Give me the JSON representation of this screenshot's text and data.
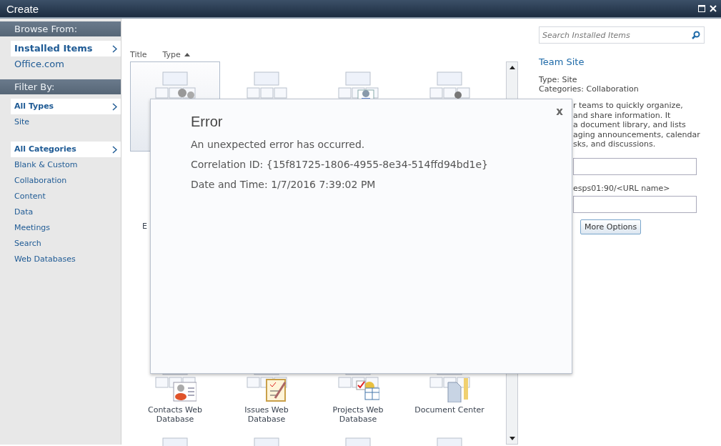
{
  "window": {
    "title": "Create"
  },
  "sidebar": {
    "sections": [
      {
        "header": "Browse From:",
        "groups": [
          {
            "items": [
              {
                "label": "Installed Items",
                "selected": true
              },
              {
                "label": "Office.com",
                "selected": false
              }
            ]
          }
        ]
      },
      {
        "header": "Filter By:",
        "groups": [
          {
            "items": [
              {
                "label": "All Types",
                "selected": true
              },
              {
                "label": "Site",
                "selected": false
              }
            ]
          },
          {
            "items": [
              {
                "label": "All Categories",
                "selected": true
              },
              {
                "label": "Blank & Custom",
                "selected": false
              },
              {
                "label": "Collaboration",
                "selected": false
              },
              {
                "label": "Content",
                "selected": false
              },
              {
                "label": "Data",
                "selected": false
              },
              {
                "label": "Meetings",
                "selected": false
              },
              {
                "label": "Search",
                "selected": false
              },
              {
                "label": "Web Databases",
                "selected": false
              }
            ]
          }
        ]
      }
    ]
  },
  "sort_columns": [
    {
      "label": "Title",
      "sorted": false
    },
    {
      "label": "Type",
      "sorted": true
    }
  ],
  "grid": {
    "rows": [
      {
        "kind": "icons",
        "tiles": [
          {
            "selected": true
          },
          {
            "selected": false
          },
          {
            "selected": false
          },
          {
            "selected": false
          }
        ]
      },
      {
        "kind": "partial",
        "tiles": [
          {
            "label": "E"
          }
        ]
      },
      {
        "kind": "full",
        "tiles": [
          {
            "label": "Contacts Web Database"
          },
          {
            "label": "Issues Web Database"
          },
          {
            "label": "Projects Web Database"
          },
          {
            "label": "Document Center"
          }
        ]
      },
      {
        "kind": "cut"
      }
    ]
  },
  "details": {
    "search": {
      "placeholder": "Search Installed Items"
    },
    "title": "Team Site",
    "type": "Type: Site",
    "categories": "Categories: Collaboration",
    "description_lines": [
      "r teams to quickly organize,",
      "and share information. It",
      "a document library, and lists",
      "aging announcements, calendar",
      "sks, and discussions."
    ],
    "url_hint": "esps01:90/<URL name>",
    "more_button": "More Options"
  },
  "error_dialog": {
    "title": "Error",
    "close": "x",
    "lines": [
      "An unexpected error has occurred.",
      "Correlation ID: {15f81725-1806-4955-8e34-514ffd94bd1e}",
      "Date and Time: 1/7/2016 7:39:02 PM"
    ]
  }
}
